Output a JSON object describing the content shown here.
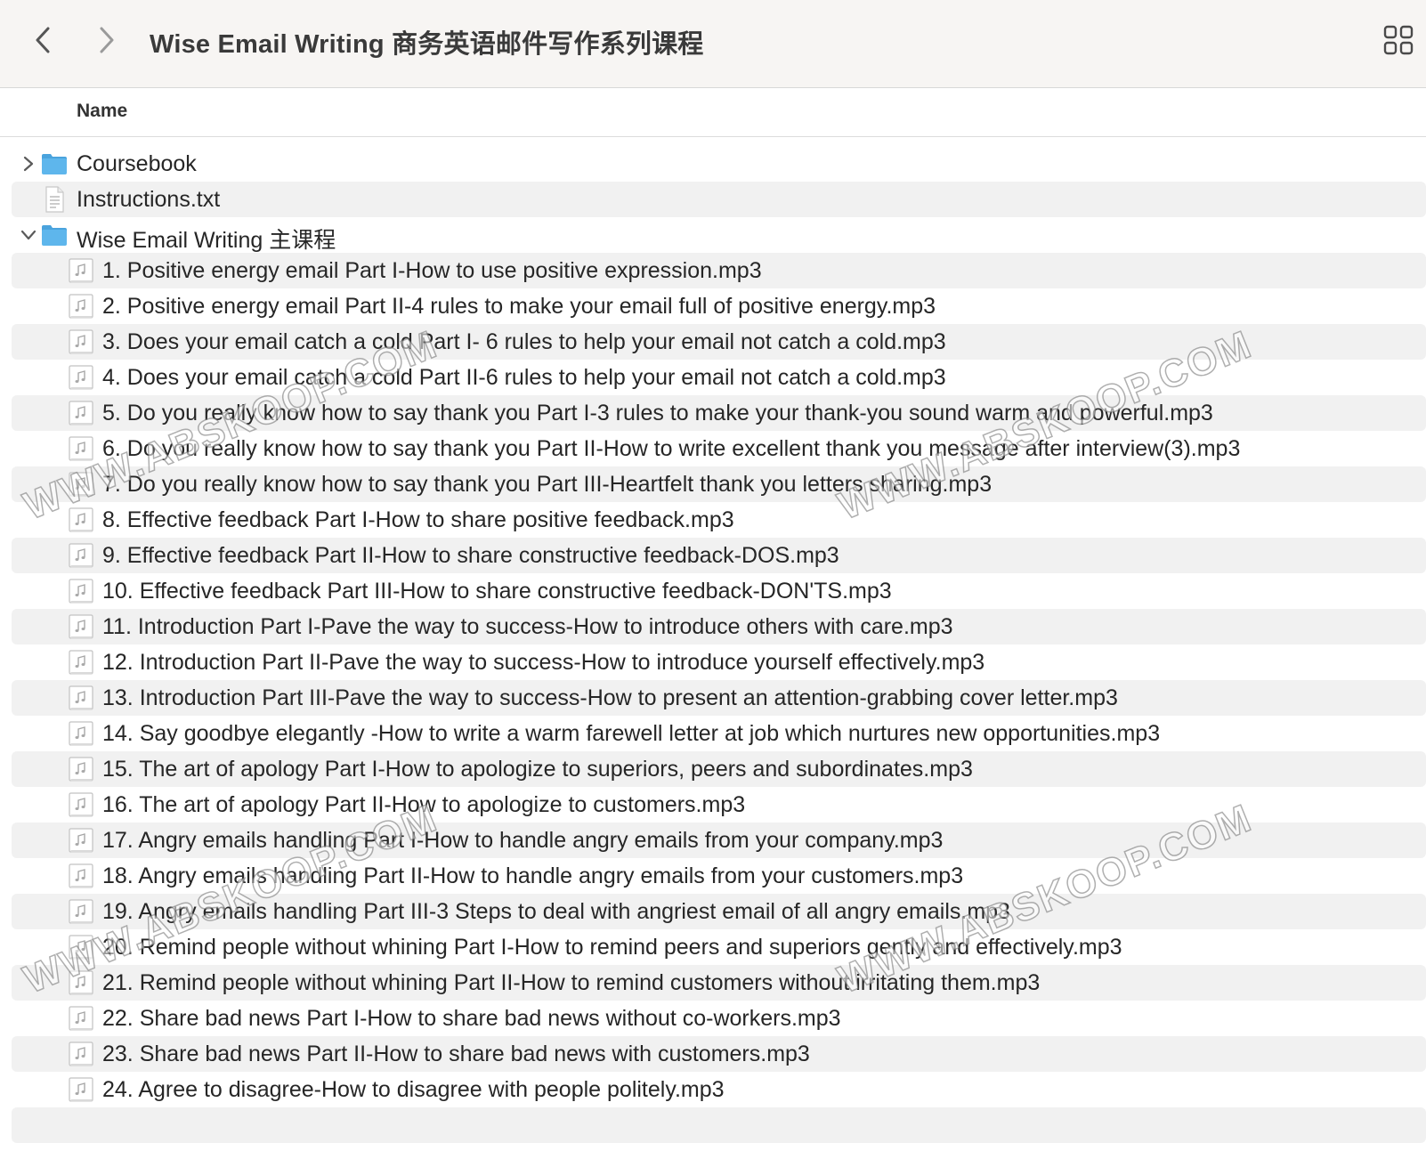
{
  "window": {
    "title": "Wise Email Writing 商务英语邮件写作系列课程"
  },
  "column_header": {
    "name": "Name"
  },
  "watermark_text": "WWW.ABSKOOP.COM",
  "files": [
    {
      "name": "Coursebook",
      "type": "folder",
      "level": 0,
      "expanded": false
    },
    {
      "name": "Instructions.txt",
      "type": "text",
      "level": 0
    },
    {
      "name": "Wise Email Writing 主课程",
      "type": "folder",
      "level": 0,
      "expanded": true
    },
    {
      "name": "1. Positive energy email Part I-How to use positive expression.mp3",
      "type": "audio",
      "level": 1
    },
    {
      "name": "2. Positive energy email Part II-4 rules to make your email full of positive energy.mp3",
      "type": "audio",
      "level": 1
    },
    {
      "name": "3. Does your email catch a cold Part I- 6 rules to help your email not catch a cold.mp3",
      "type": "audio",
      "level": 1
    },
    {
      "name": "4. Does your email catch a cold Part II-6 rules to help your email not catch a cold.mp3",
      "type": "audio",
      "level": 1
    },
    {
      "name": "5. Do you really know how to say thank you Part I-3 rules to make your thank-you sound warm and powerful.mp3",
      "type": "audio",
      "level": 1
    },
    {
      "name": "6. Do you really know how to say thank you Part II-How to write excellent thank you message after interview(3).mp3",
      "type": "audio",
      "level": 1
    },
    {
      "name": "7. Do you really know how to say thank you Part III-Heartfelt thank you letters sharing.mp3",
      "type": "audio",
      "level": 1
    },
    {
      "name": "8. Effective feedback Part I-How to share positive feedback.mp3",
      "type": "audio",
      "level": 1
    },
    {
      "name": "9. Effective feedback Part II-How to share constructive feedback-DOS.mp3",
      "type": "audio",
      "level": 1
    },
    {
      "name": "10. Effective feedback Part III-How to share constructive feedback-DON'TS.mp3",
      "type": "audio",
      "level": 1
    },
    {
      "name": "11. Introduction Part I-Pave the way to success-How to introduce others with care.mp3",
      "type": "audio",
      "level": 1
    },
    {
      "name": "12. Introduction Part II-Pave the way to success-How to introduce yourself effectively.mp3",
      "type": "audio",
      "level": 1
    },
    {
      "name": "13. Introduction Part III-Pave the way to success-How to present an attention-grabbing cover letter.mp3",
      "type": "audio",
      "level": 1
    },
    {
      "name": "14. Say goodbye elegantly -How to write a warm farewell letter at job which nurtures new opportunities.mp3",
      "type": "audio",
      "level": 1
    },
    {
      "name": "15. The art of apology Part I-How to apologize to superiors, peers and subordinates.mp3",
      "type": "audio",
      "level": 1
    },
    {
      "name": "16. The art of apology Part II-How to apologize to customers.mp3",
      "type": "audio",
      "level": 1
    },
    {
      "name": "17. Angry emails handling Part I-How to handle angry emails from your company.mp3",
      "type": "audio",
      "level": 1
    },
    {
      "name": "18. Angry emails handling Part II-How to handle angry emails from your customers.mp3",
      "type": "audio",
      "level": 1
    },
    {
      "name": "19. Angry emails handling Part III-3 Steps to deal with angriest email of all angry emails.mp3",
      "type": "audio",
      "level": 1
    },
    {
      "name": "20. Remind people without whining Part I-How to remind peers and superiors gently and effectively.mp3",
      "type": "audio",
      "level": 1
    },
    {
      "name": "21. Remind people without whining Part II-How to remind customers without irritating them.mp3",
      "type": "audio",
      "level": 1
    },
    {
      "name": "22. Share bad news Part I-How to share bad news without co-workers.mp3",
      "type": "audio",
      "level": 1
    },
    {
      "name": "23. Share bad news Part II-How to share bad news with customers.mp3",
      "type": "audio",
      "level": 1
    },
    {
      "name": "24. Agree to disagree-How to disagree with people politely.mp3",
      "type": "audio",
      "level": 1
    }
  ],
  "colors": {
    "folder": "#5eb6ec",
    "folder_tab": "#4aa3dd",
    "row_alt": "#f1f1f1",
    "titlebar": "#f7f5f3"
  }
}
